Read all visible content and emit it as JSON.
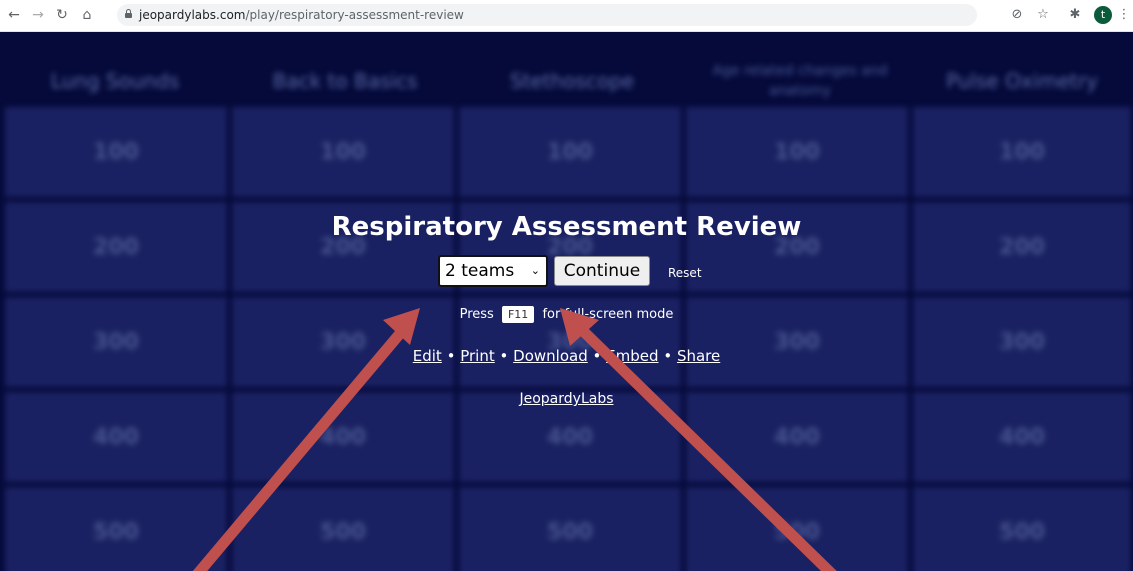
{
  "browser": {
    "url_host": "jeopardylabs.com",
    "url_path": "/play/respiratory-assessment-review",
    "profile_initial": "t"
  },
  "board": {
    "categories": [
      "Lung Sounds",
      "Back to Basics",
      "Stethoscope",
      "Age related changes and anatomy",
      "Pulse Oximetry"
    ],
    "point_values": [
      "100",
      "200",
      "300",
      "400",
      "500"
    ]
  },
  "game": {
    "title": "Respiratory Assessment Review",
    "team_select_value": "2 teams",
    "continue_label": "Continue",
    "reset_label": "Reset",
    "press_prefix": "Press",
    "press_key": "F11",
    "press_suffix": "for full-screen mode",
    "links": {
      "edit": "Edit",
      "print": "Print",
      "download": "Download",
      "embed": "Embed",
      "share": "Share",
      "separator": "•"
    },
    "brand_link": "JeopardyLabs"
  },
  "colors": {
    "page_bg": "#050a3a",
    "cell_bg": "#1a2162",
    "arrow": "#c0504d"
  }
}
